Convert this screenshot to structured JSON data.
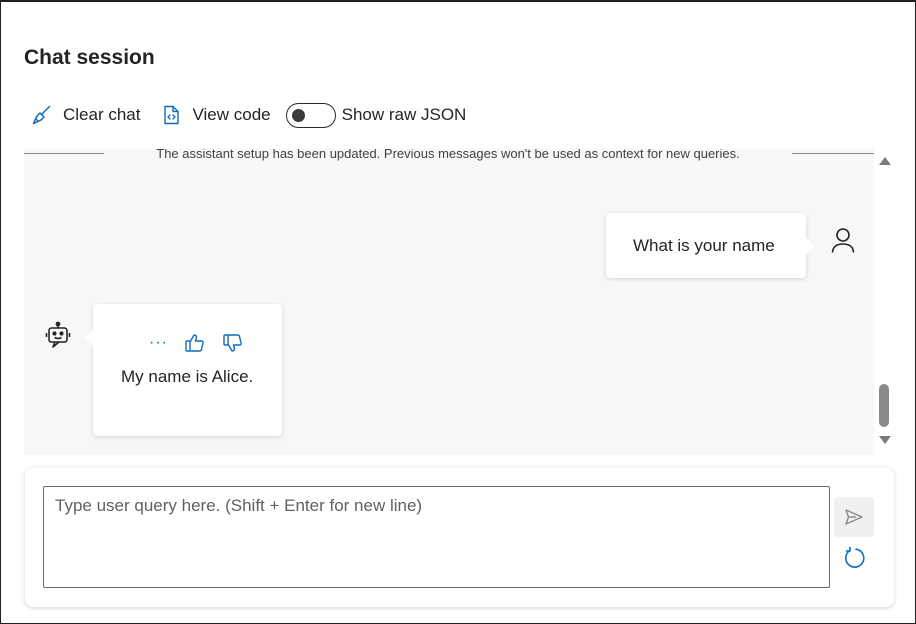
{
  "header": {
    "title": "Chat session"
  },
  "toolbar": {
    "clear_chat_label": "Clear chat",
    "clear_chat_icon": "broom-icon",
    "view_code_label": "View code",
    "view_code_icon": "code-file-icon",
    "show_raw_json_label": "Show raw JSON",
    "show_raw_json_on": false
  },
  "chat": {
    "notice": "The assistant setup has been updated. Previous messages won't be used as context for new queries.",
    "messages": [
      {
        "role": "user",
        "text": "What is your name",
        "icon": "person-icon"
      },
      {
        "role": "assistant",
        "text": "My name is Alice.",
        "icon": "bot-icon",
        "actions": {
          "more": "···"
        }
      }
    ]
  },
  "input": {
    "placeholder": "Type user query here. (Shift + Enter for new line)",
    "value": "",
    "send_icon": "send-icon",
    "refresh_icon": "refresh-icon"
  },
  "colors": {
    "accent": "#0f6cbd",
    "chat_bg": "#f8f7f5",
    "text": "#242424"
  }
}
